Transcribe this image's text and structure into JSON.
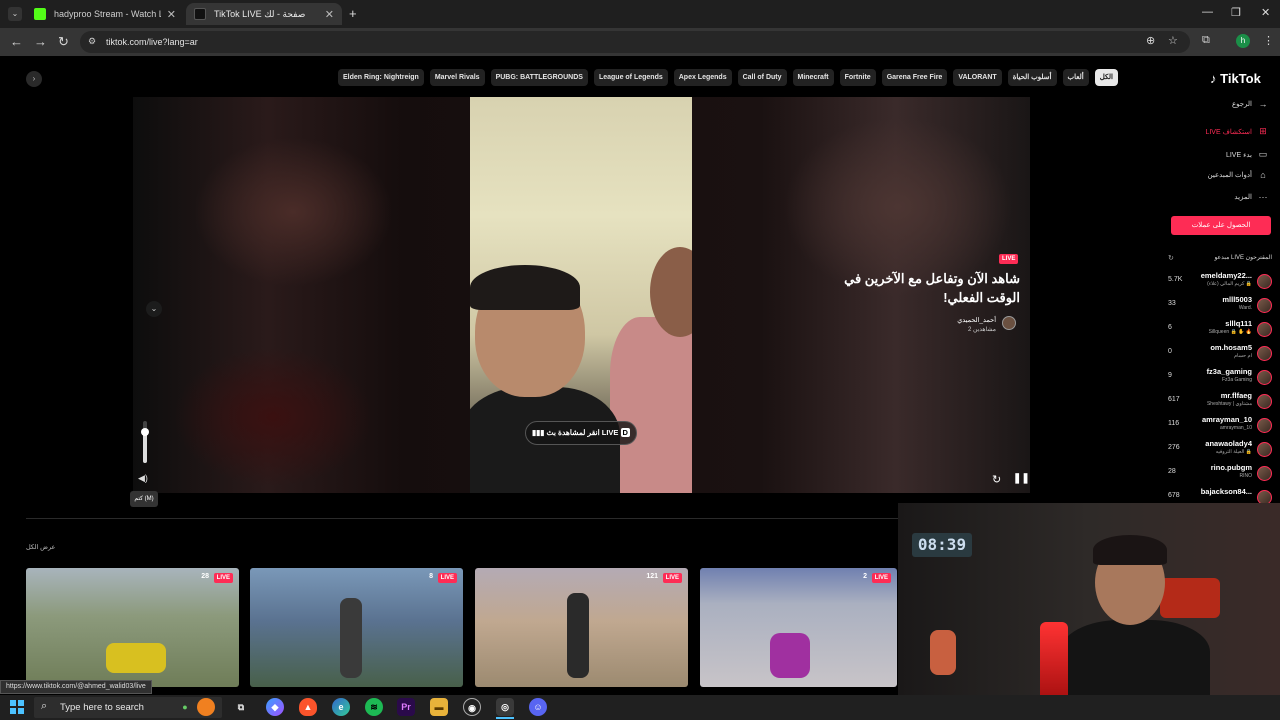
{
  "browser": {
    "tabs": [
      {
        "title": "hadyproo Stream - Watch Live"
      },
      {
        "title": "TikTok LIVE صفحة - لك"
      }
    ],
    "url": "tiktok.com/live?lang=ar",
    "profile_initial": "h",
    "status_url": "https://www.tiktok.com/@ahmed_walid03/live"
  },
  "header": {
    "logo": "TikTok",
    "categories": [
      "Elden Ring: Nightreign",
      "Marvel Rivals",
      "PUBG: BATTLEGROUNDS",
      "League of Legends",
      "Apex Legends",
      "Call of Duty",
      "Minecraft",
      "Fortnite",
      "Garena Free Fire",
      "VALORANT",
      "أسلوب الحياة",
      "ألعاب",
      "الكل"
    ],
    "active_category": "الكل"
  },
  "sidebar": {
    "items": [
      {
        "label": "الرجوع",
        "icon": "→"
      },
      {
        "label": "استكشاف LIVE",
        "icon": "⊞",
        "active": true
      },
      {
        "label": "بدء LIVE",
        "icon": "▭"
      },
      {
        "label": "أدوات المبدعين",
        "icon": "⌂"
      },
      {
        "label": "المزيد",
        "icon": "···"
      }
    ],
    "cta": "الحصول على عملات",
    "suggested_heading": "مبدعو LIVE المقترحون",
    "creators": [
      {
        "name": "emeldamy22...",
        "sub": "كريم المالي (علاء) 🔒",
        "count": "5.7K"
      },
      {
        "name": "mlll5003",
        "sub": "Ward.",
        "count": "33"
      },
      {
        "name": "slllq111",
        "sub": "Sillqueen 🔒 ✋ 🔥",
        "count": "6"
      },
      {
        "name": "om.hosam5",
        "sub": "ام حسام",
        "count": "0"
      },
      {
        "name": "fz3a_gaming",
        "sub": "Fz3a Gaming",
        "count": "9"
      },
      {
        "name": "mr.flfaeg",
        "sub": "Sheshtawy | مشتاوي",
        "count": "617"
      },
      {
        "name": "amrayman_10",
        "sub": "amrayman_10",
        "count": "116"
      },
      {
        "name": "anawaolady4",
        "sub": "العيلة التروفيه 🔒",
        "count": "276"
      },
      {
        "name": "rino.pubgm",
        "sub": "RINO",
        "count": "28"
      },
      {
        "name": "bajackson84...",
        "sub": "",
        "count": "678"
      }
    ]
  },
  "player": {
    "watch_button": "انقر لمشاهدة بث LIVE",
    "live_badge": "LIVE",
    "headline": "شاهد الآن وتفاعل مع الآخرين في الوقت الفعلي!",
    "host_name": "أحمد_الحميدي",
    "host_viewers": "2 مشاهدين",
    "mute_tooltip": "كتم (M)"
  },
  "recommended": {
    "see_all": "عرض الكل",
    "thumbs": [
      {
        "count": "28",
        "live": "LIVE"
      },
      {
        "count": "8",
        "live": "LIVE"
      },
      {
        "count": "121",
        "live": "LIVE"
      },
      {
        "count": "2",
        "live": "LIVE"
      }
    ]
  },
  "webcam": {
    "clock": "08:39"
  },
  "taskbar": {
    "search_placeholder": "Type here to search"
  }
}
